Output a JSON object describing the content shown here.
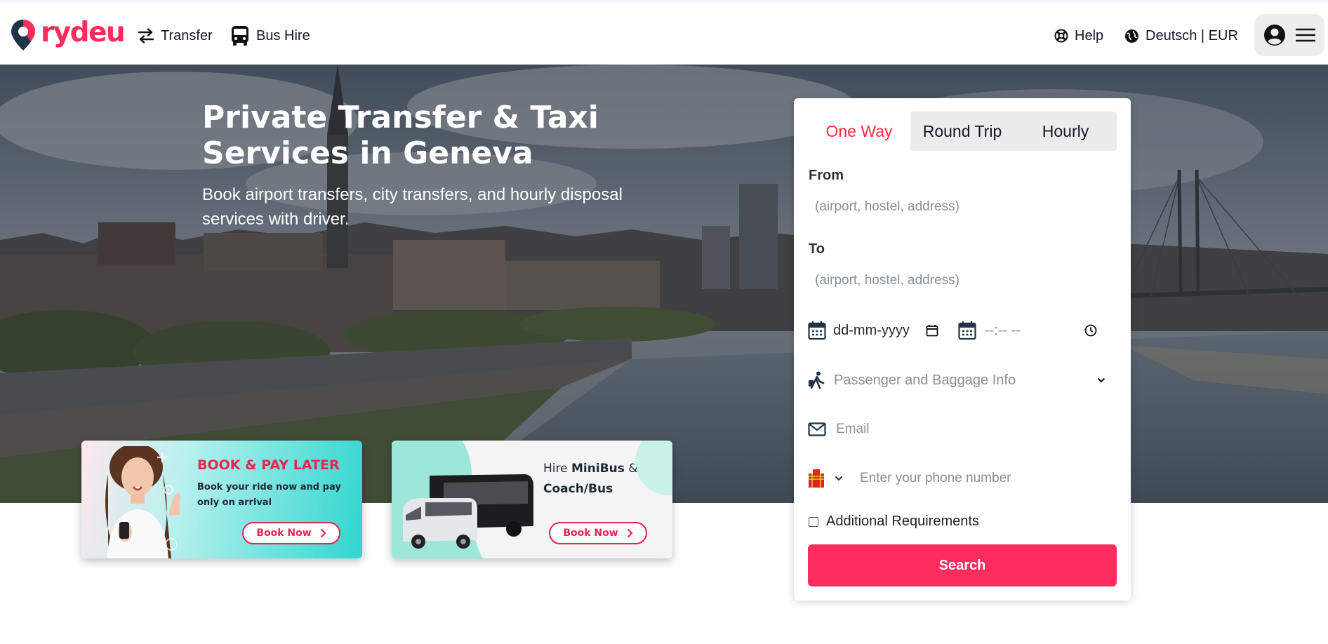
{
  "brand": {
    "name": "rydeu",
    "color": "#ff2c5e"
  },
  "nav": {
    "transfer": "Transfer",
    "bus_hire": "Bus Hire",
    "help": "Help",
    "language": "Deutsch | EUR"
  },
  "hero": {
    "title": "Private Transfer & Taxi Services in Geneva",
    "subtitle": "Book airport transfers, city transfers, and hourly disposal services with driver."
  },
  "promos": [
    {
      "title": "BOOK & PAY LATER",
      "text": "Book your ride now and pay only on arrival",
      "button": "Book Now"
    },
    {
      "text_prefix": "Hire ",
      "text_bold1": "MiniBus",
      "text_mid": " & ",
      "text_bold2": "Coach/Bus",
      "button": "Book Now"
    }
  ],
  "form": {
    "tabs": [
      "One Way",
      "Round Trip",
      "Hourly"
    ],
    "active_tab": "One Way",
    "from_label": "From",
    "from_placeholder": "(airport, hostel, address)",
    "to_label": "To",
    "to_placeholder": "(airport, hostel, address)",
    "date_placeholder": "dd-mm-yyyy",
    "time_placeholder": "--:-- --",
    "passenger_placeholder": "Passenger and Baggage Info",
    "email_placeholder": "Email",
    "phone_placeholder": "Enter your phone number",
    "additional_requirements": "Additional Requirements",
    "search_button": "Search",
    "accent_color": "#ff2c5e"
  },
  "icons": {
    "transfer": "arrows-left-right-icon",
    "bus": "bus-icon",
    "help": "lifebuoy-icon",
    "language": "globe-icon",
    "user": "user-circle-icon",
    "menu": "hamburger-menu-icon",
    "calendar": "calendar-icon",
    "clock": "clock-icon",
    "passenger": "walking-traveler-icon",
    "email": "envelope-icon",
    "flag": "flag-icon"
  }
}
